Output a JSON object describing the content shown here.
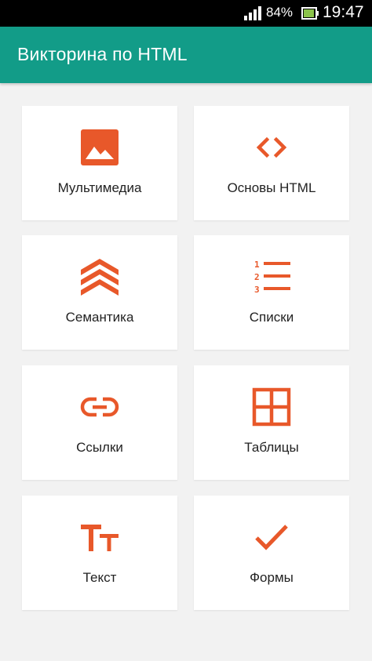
{
  "status_bar": {
    "battery_percent": "84%",
    "time": "19:47"
  },
  "app_bar": {
    "title": "Викторина по HTML"
  },
  "colors": {
    "accent": "#e8582a",
    "app_bar": "#129c88",
    "background": "#f2f2f2"
  },
  "categories": [
    {
      "label": "Мультимедиа",
      "icon": "image-icon"
    },
    {
      "label": "Основы HTML",
      "icon": "code-icon"
    },
    {
      "label": "Семантика",
      "icon": "chevrons-up-icon"
    },
    {
      "label": "Списки",
      "icon": "numbered-list-icon"
    },
    {
      "label": "Ссылки",
      "icon": "link-icon"
    },
    {
      "label": "Таблицы",
      "icon": "table-grid-icon"
    },
    {
      "label": "Текст",
      "icon": "text-size-icon"
    },
    {
      "label": "Формы",
      "icon": "checkmark-icon"
    }
  ]
}
